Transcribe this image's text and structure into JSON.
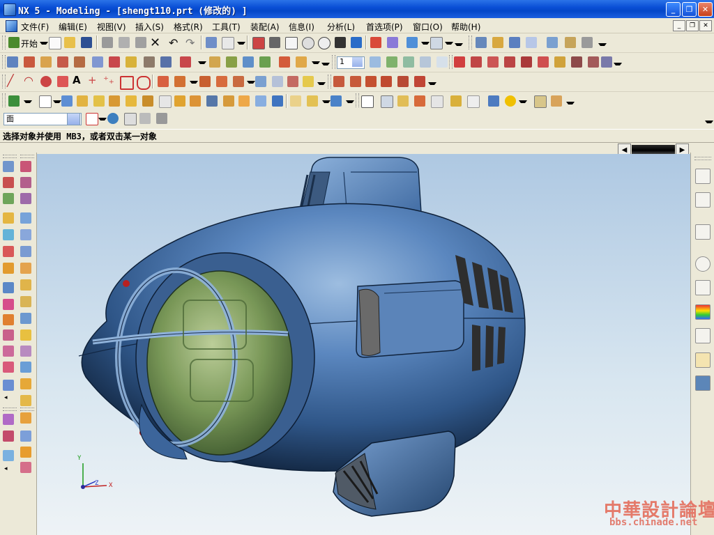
{
  "window": {
    "title": "NX 5 - Modeling - [shengt110.prt  (修改的) ]",
    "min_glyph": "_",
    "max_glyph": "❐",
    "close_glyph": "✕"
  },
  "menu": {
    "items": [
      "文件(F)",
      "编辑(E)",
      "视图(V)",
      "插入(S)",
      "格式(R)",
      "工具(T)",
      "装配(A)",
      "信息(I)",
      "分析(L)",
      "首选项(P)",
      "窗口(O)",
      "帮助(H)"
    ]
  },
  "standard_toolbar": {
    "start_label": "开始"
  },
  "layer_field": {
    "value": "1"
  },
  "selection_bar": {
    "filter_value": "面"
  },
  "status": {
    "prompt": "选择对象并使用 MB3，或者双击某一对象"
  },
  "triad": {
    "x": "X",
    "y": "Y",
    "z": "Z"
  },
  "watermark": {
    "cn": "中華設計論壇",
    "url": "bbs.chinade.net"
  },
  "colors": {
    "model_body": "#4d7bb0",
    "canopy_glass": "#7f9e5a",
    "titlebar": "#0a4fd6"
  }
}
